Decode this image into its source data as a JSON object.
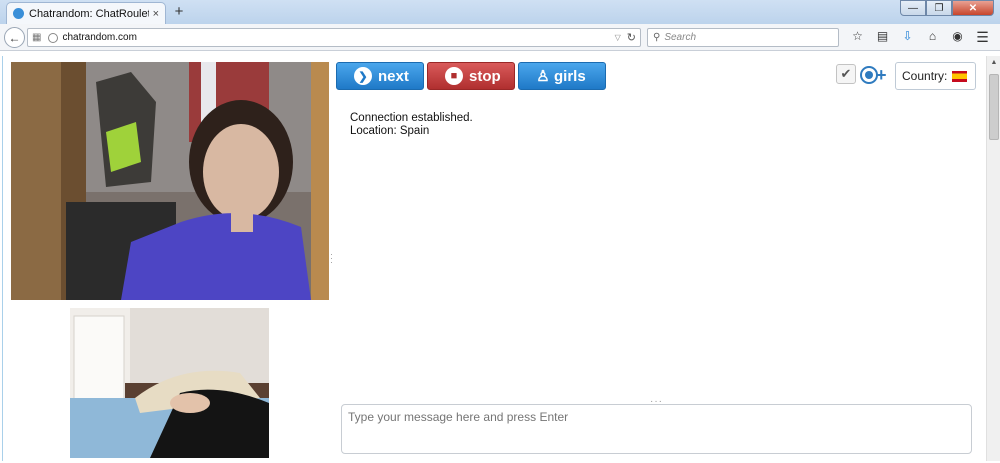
{
  "browser": {
    "tab_title": "Chatrandom: ChatRoulette...",
    "tab_close": "×",
    "new_tab": "+",
    "url": "chatrandom.com",
    "search_placeholder": "Search",
    "window_min": "—",
    "window_max": "❐",
    "window_close": "✕",
    "icons": [
      "back-icon",
      "bookmark-star-icon",
      "reading-list-icon",
      "download-icon",
      "home-icon",
      "addon-icon",
      "menu-icon"
    ]
  },
  "controls": {
    "next_label": "next",
    "stop_label": "stop",
    "girls_label": "girls",
    "country_label": "Country:",
    "country_flag": "spain-flag"
  },
  "chat": {
    "status_line1": "Connection established.",
    "status_line2": "Location: Spain",
    "message_placeholder": "Type your message here and press Enter"
  },
  "colors": {
    "next_button": "#1f79c7",
    "stop_button": "#b02f2f",
    "girls_button": "#1f79c7"
  }
}
